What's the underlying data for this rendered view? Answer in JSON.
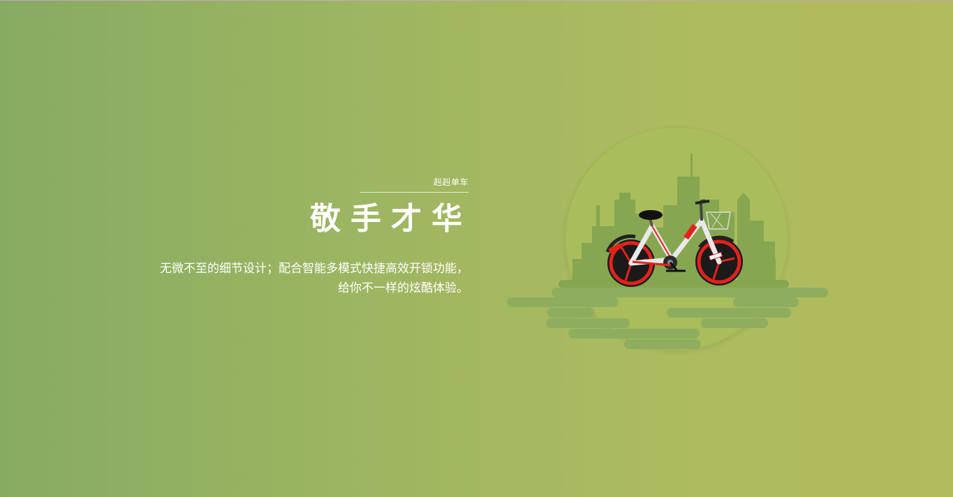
{
  "hero": {
    "brand": "赳赳单车",
    "headline": "敬手才华",
    "description": "无微不至的细节设计；配合智能多模式快捷高效开锁功能，给你不一样的炫酷体验。"
  },
  "illustration": {
    "subject": "bike-icon",
    "colors": {
      "circle": "#a9bd5c",
      "city": "#86a650",
      "ground": "#8fad5e",
      "wheel_rim": "#e2231a",
      "tire": "#1a1a1a",
      "frame": "#e9e9e9"
    }
  }
}
